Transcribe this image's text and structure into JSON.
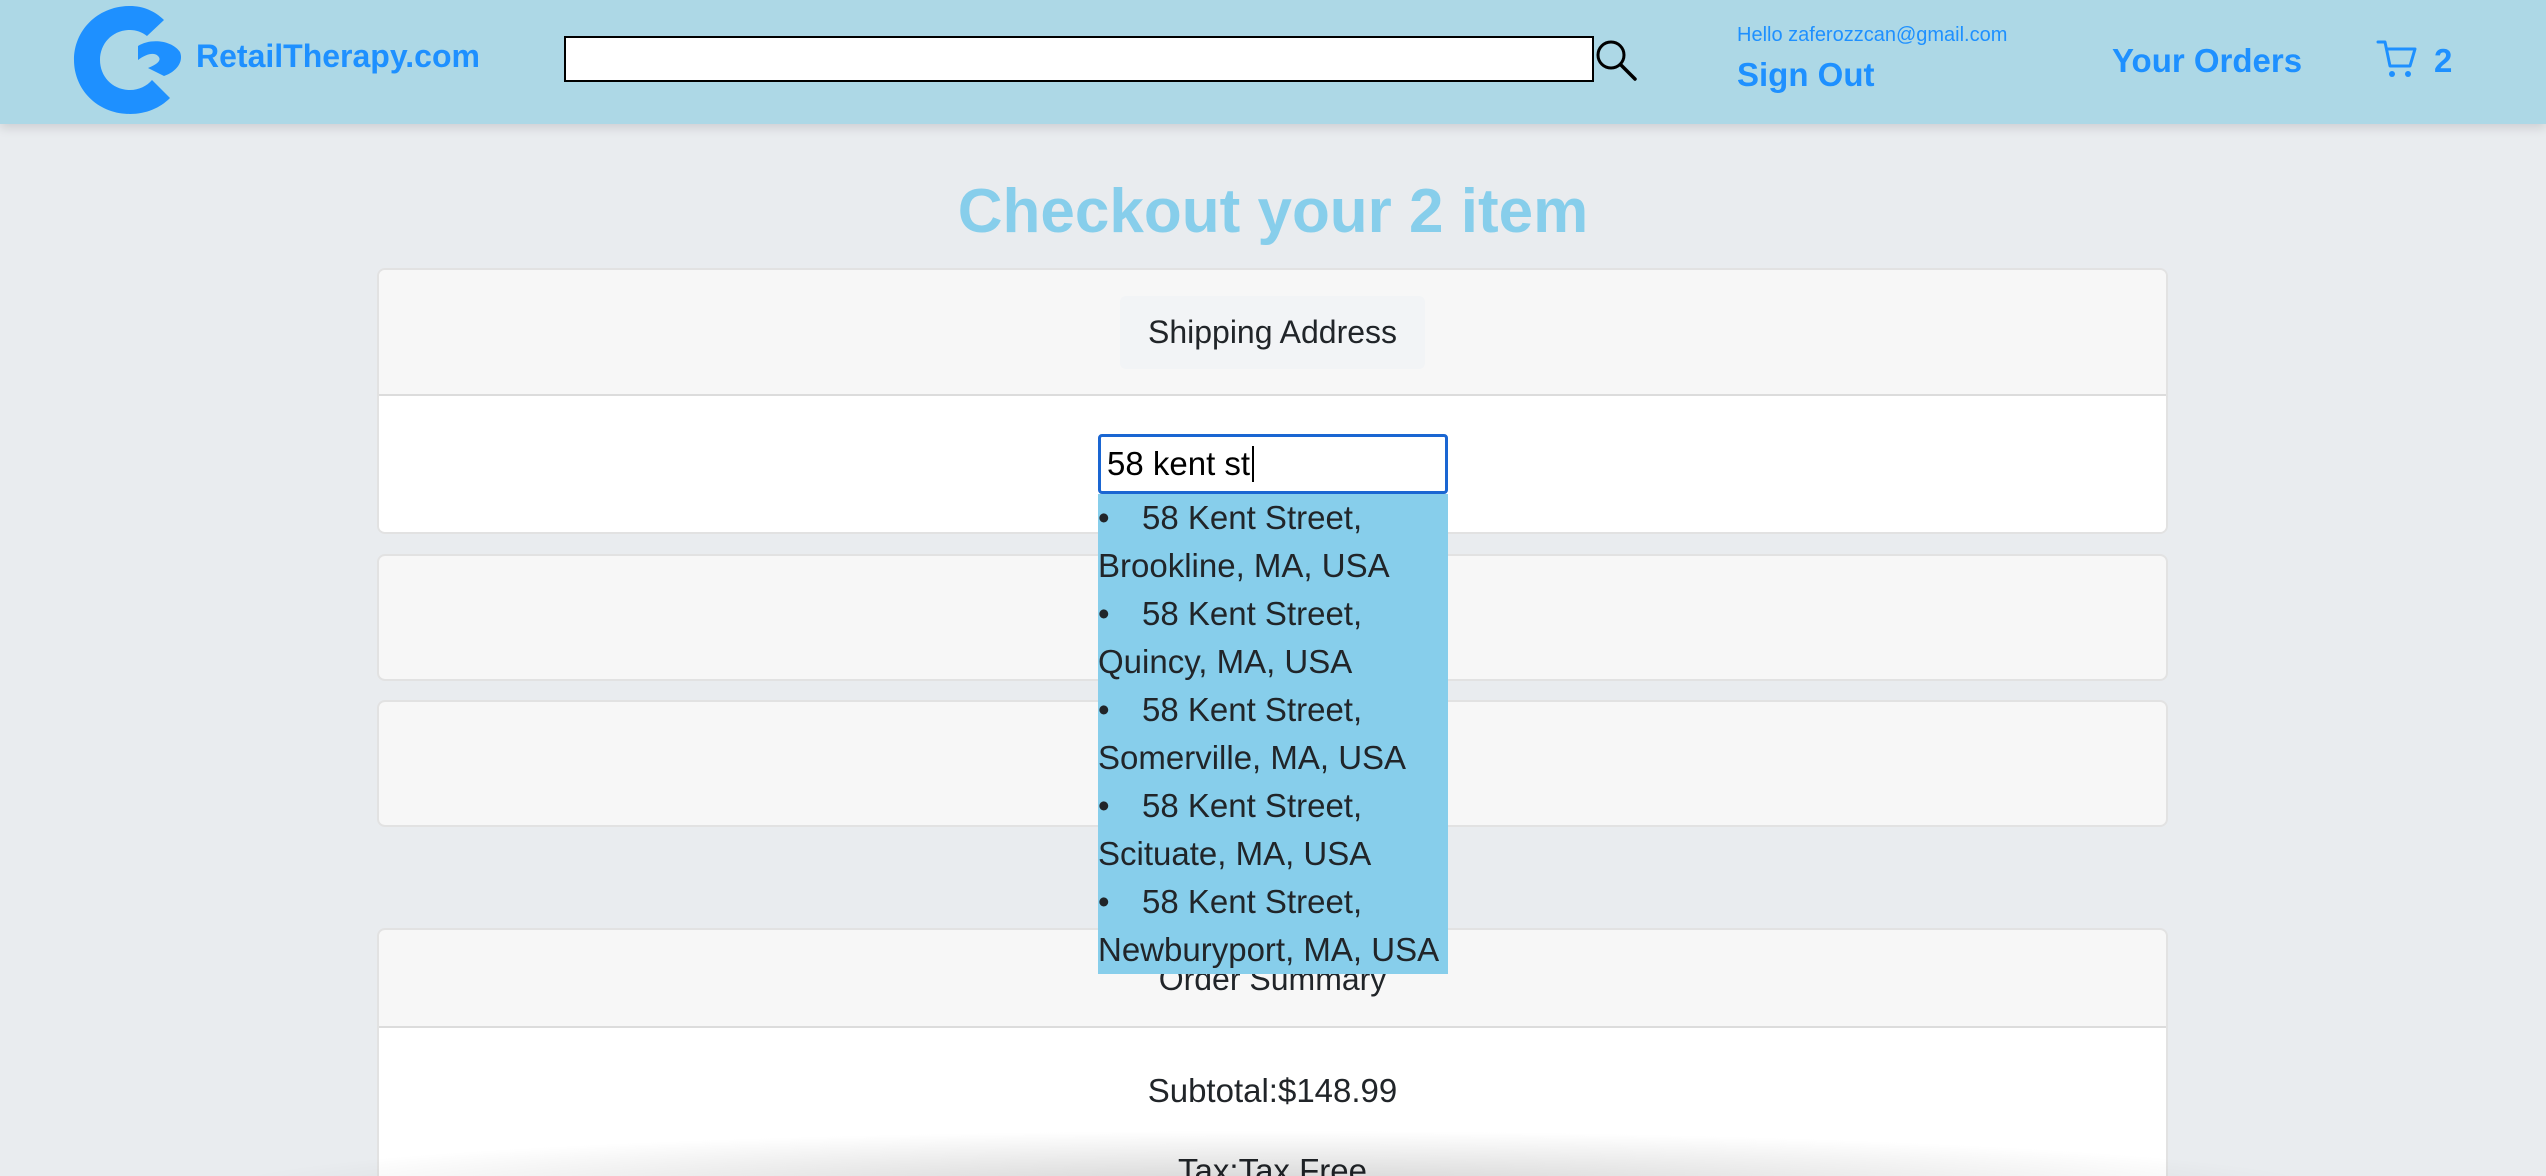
{
  "header": {
    "brand": "RetailTherapy.com",
    "search_value": "",
    "greeting": "Hello zaferozzcan@gmail.com",
    "sign_out": "Sign Out",
    "orders": "Your Orders",
    "cart_count": "2",
    "icons": [
      "logo-icon",
      "search-icon",
      "cart-icon"
    ],
    "colors": {
      "header_bg": "#add8e6",
      "accent": "#1e90ff"
    }
  },
  "page": {
    "title": "Checkout your 2 item"
  },
  "shipping": {
    "header": "Shipping Address",
    "input_value": "58 kent st",
    "suggestions": [
      {
        "line1": "58 Kent Street,",
        "line2": "Brookline, MA, USA"
      },
      {
        "line1": "58 Kent Street,",
        "line2": "Quincy, MA, USA"
      },
      {
        "line1": "58 Kent Street,",
        "line2": "Somerville, MA, USA"
      },
      {
        "line1": "58 Kent Street,",
        "line2": "Scituate, MA, USA"
      },
      {
        "line1": "58 Kent Street,",
        "line2": "Newburyport, MA, USA"
      }
    ],
    "bullet": "•"
  },
  "summary": {
    "header": "Order Summary",
    "subtotal": "Subtotal:$148.99",
    "tax": "Tax:Tax Free"
  },
  "colors": {
    "title": "#87ceeb",
    "dropdown_bg": "#87ceeb",
    "input_border": "#1a66d2"
  }
}
